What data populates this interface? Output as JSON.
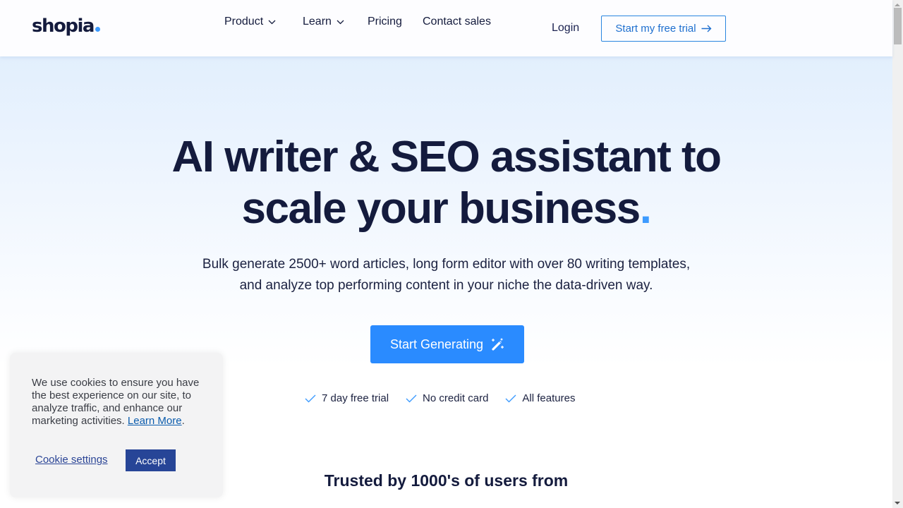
{
  "header": {
    "logo_text": "shopia",
    "nav": [
      {
        "label": "Product",
        "has_dropdown": true,
        "icon": "chevron-down-icon"
      },
      {
        "label": "Learn",
        "has_dropdown": true,
        "icon": "chevron-down-icon"
      },
      {
        "label": "Pricing",
        "has_dropdown": false
      },
      {
        "label": "Contact sales",
        "has_dropdown": false
      }
    ],
    "login_label": "Login",
    "trial_button_label": "Start my free trial",
    "trial_button_icon": "arrow-right-icon"
  },
  "hero": {
    "title_line1": "AI writer & SEO assistant to",
    "title_line2": "scale your business",
    "title_dot": ".",
    "subtitle_line1": "Bulk generate 2500+ word articles, long form editor with over 80 writing templates,",
    "subtitle_line2": "and analyze top performing content in your niche the data-driven way.",
    "cta_label": "Start Generating",
    "cta_icon": "magic-wand-icon",
    "perks": [
      {
        "label": "7 day free trial",
        "icon": "check-icon"
      },
      {
        "label": "No credit card",
        "icon": "check-icon"
      },
      {
        "label": "All features",
        "icon": "check-icon"
      }
    ],
    "trusted_text": "Trusted by 1000's of users from"
  },
  "cookie_banner": {
    "text": "We use cookies to ensure you have the best experience on our site, to analyze traffic, and enhance our marketing activities.",
    "learn_more_label": "Learn More",
    "trailing": ".",
    "settings_label": "Cookie settings",
    "accept_label": "Accept"
  },
  "colors": {
    "brand_dark": "#141b3d",
    "accent_blue": "#2a8bff",
    "logo_dot": "#3d9bff",
    "outline_button": "#2a86e0",
    "cookie_accept": "#274597"
  }
}
